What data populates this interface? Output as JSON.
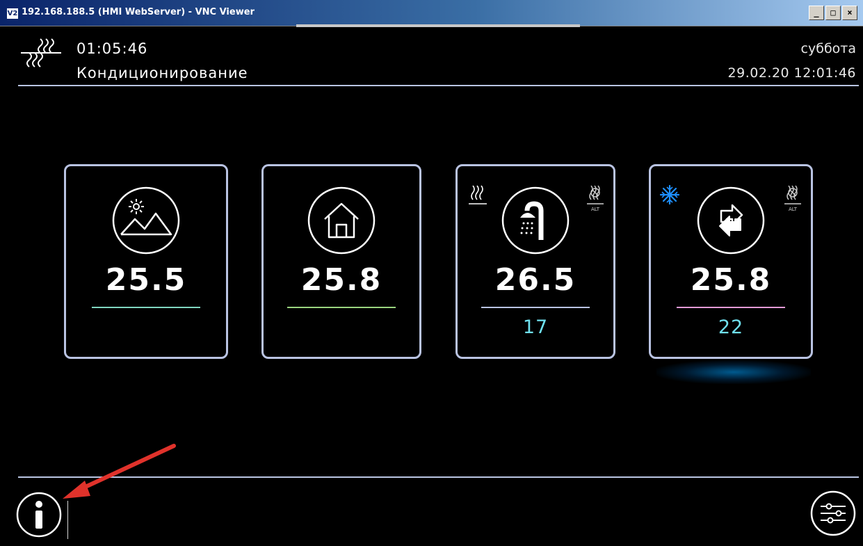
{
  "window": {
    "icon": "V2",
    "title": "192.168.188.5 (HMI WebServer) - VNC Viewer",
    "buttons": [
      "_",
      "□",
      "×"
    ]
  },
  "header": {
    "logo_icon": "heating-waves-icon",
    "timer": "01:05:46",
    "mode": "Кондиционирование",
    "weekday": "суббота",
    "datetime": "29.02.20 12:01:46"
  },
  "cards": [
    {
      "id": "outdoor",
      "icon": "outdoor-mountains-sun-icon",
      "value": "25.5",
      "setpoint": "",
      "underline_color": "#7fd6c0"
    },
    {
      "id": "indoor",
      "icon": "house-icon",
      "value": "25.8",
      "setpoint": "",
      "underline_color": "#9ad47e"
    },
    {
      "id": "hot-water",
      "icon": "shower-icon",
      "value": "26.5",
      "setpoint": "17",
      "underline_color": "#b9c3e2",
      "corner_left": "heating-waves-icon",
      "corner_right": "heating-off-alt-icon",
      "corner_right_label": "ALT"
    },
    {
      "id": "recirculation",
      "icon": "swap-arrows-icon",
      "value": "25.8",
      "setpoint": "22",
      "underline_color": "#e29ad6",
      "corner_left": "snowflake-icon",
      "corner_right": "heating-off-alt-icon",
      "corner_right_label": "ALT"
    }
  ],
  "footer": {
    "info_button": "info-icon",
    "settings_button": "settings-sliders-icon"
  },
  "colors": {
    "background": "#000000",
    "frame": "#b9c3e2",
    "setpoint": "#6fe0ee",
    "snowflake": "#1e90ff",
    "annotation_arrow": "#e0322b"
  }
}
